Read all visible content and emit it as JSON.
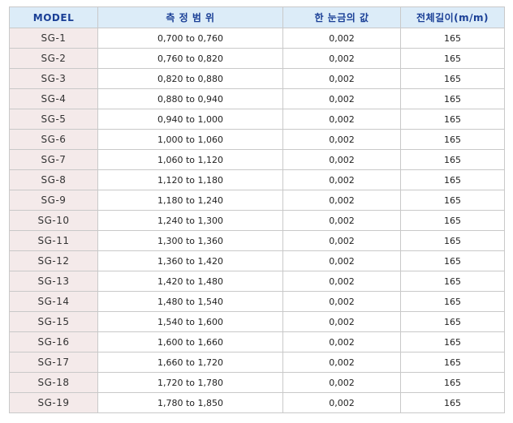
{
  "table": {
    "headers": [
      "MODEL",
      "측 정 범 위",
      "한 눈금의 값",
      "전체길이(m/m)"
    ],
    "rows": [
      {
        "model": "SG-1",
        "range": "0,700 to 0,760",
        "graduation": "0,002",
        "length": "165"
      },
      {
        "model": "SG-2",
        "range": "0,760 to 0,820",
        "graduation": "0,002",
        "length": "165"
      },
      {
        "model": "SG-3",
        "range": "0,820 to 0,880",
        "graduation": "0,002",
        "length": "165"
      },
      {
        "model": "SG-4",
        "range": "0,880 to 0,940",
        "graduation": "0,002",
        "length": "165"
      },
      {
        "model": "SG-5",
        "range": "0,940 to 1,000",
        "graduation": "0,002",
        "length": "165"
      },
      {
        "model": "SG-6",
        "range": "1,000 to 1,060",
        "graduation": "0,002",
        "length": "165"
      },
      {
        "model": "SG-7",
        "range": "1,060 to 1,120",
        "graduation": "0,002",
        "length": "165"
      },
      {
        "model": "SG-8",
        "range": "1,120 to 1,180",
        "graduation": "0,002",
        "length": "165"
      },
      {
        "model": "SG-9",
        "range": "1,180 to 1,240",
        "graduation": "0,002",
        "length": "165"
      },
      {
        "model": "SG-10",
        "range": "1,240 to 1,300",
        "graduation": "0,002",
        "length": "165"
      },
      {
        "model": "SG-11",
        "range": "1,300 to 1,360",
        "graduation": "0,002",
        "length": "165"
      },
      {
        "model": "SG-12",
        "range": "1,360 to 1,420",
        "graduation": "0,002",
        "length": "165"
      },
      {
        "model": "SG-13",
        "range": "1,420 to 1,480",
        "graduation": "0,002",
        "length": "165"
      },
      {
        "model": "SG-14",
        "range": "1,480 to 1,540",
        "graduation": "0,002",
        "length": "165"
      },
      {
        "model": "SG-15",
        "range": "1,540 to 1,600",
        "graduation": "0,002",
        "length": "165"
      },
      {
        "model": "SG-16",
        "range": "1,600 to 1,660",
        "graduation": "0,002",
        "length": "165"
      },
      {
        "model": "SG-17",
        "range": "1,660 to 1,720",
        "graduation": "0,002",
        "length": "165"
      },
      {
        "model": "SG-18",
        "range": "1,720 to 1,780",
        "graduation": "0,002",
        "length": "165"
      },
      {
        "model": "SG-19",
        "range": "1,780 to 1,850",
        "graduation": "0,002",
        "length": "165"
      }
    ]
  },
  "colors": {
    "header_bg": "#dcecf8",
    "header_text": "#1a3f96",
    "model_cell_bg": "#f4eaea",
    "border": "#c9c9c9"
  }
}
